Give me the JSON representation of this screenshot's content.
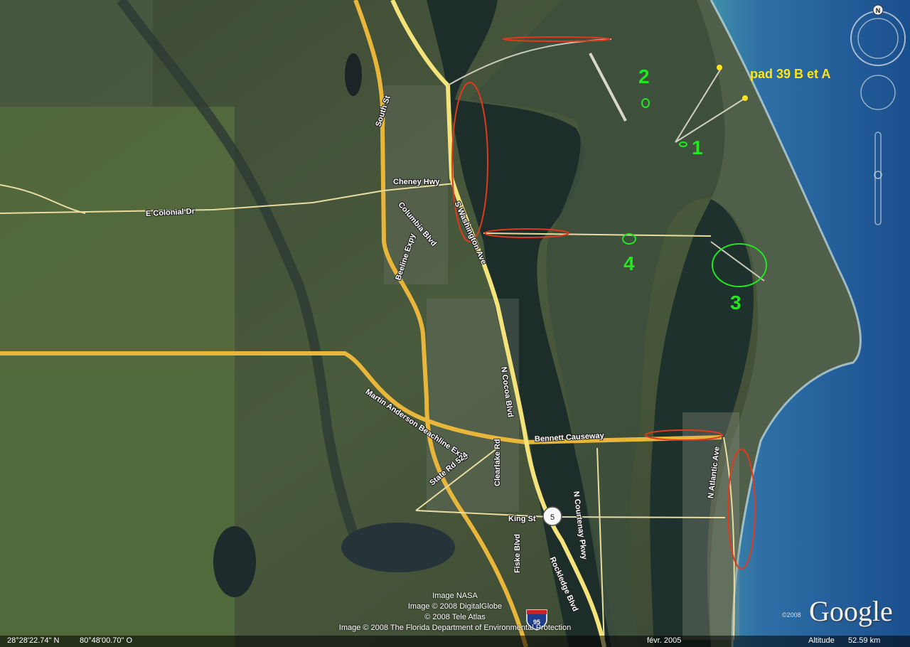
{
  "roads": {
    "south_st": "South St",
    "cheney_hwy": "Cheney Hwy",
    "colonial": "E Colonial Dr",
    "columbia": "Columbia Blvd",
    "beeline": "Beeline Expy",
    "s_washington": "S Washington Ave",
    "n_cocoa": "N Cocoa Blvd",
    "martin_anderson": "Martin Anderson Beachline Expy",
    "bennett": "Bennett Causeway",
    "n_courtenay": "N Courtenay Pkwy",
    "state_rd": "State Rd 524",
    "clearlake": "Clearlake Rd",
    "king_st": "King St",
    "fiske": "Fiske Blvd",
    "rockledge": "Rockledge Blvd",
    "n_atlantic": "N Atlantic Ave",
    "i95_shield": "95",
    "route5": "5"
  },
  "markers": {
    "m1": "1",
    "m2": "2",
    "m3": "3",
    "m4": "4",
    "pad_label": "pad 39 B et A"
  },
  "credits": {
    "line1": "Image NASA",
    "line2": "Image © 2008 DigitalGlobe",
    "line3": "© 2008 Tele Atlas",
    "line4": "Image © 2008 The Florida Department of Environmental Protection"
  },
  "status": {
    "lat": "28°28'22.74\" N",
    "lon": "80°48'00.70\" O",
    "date": "févr. 2005",
    "altitude_label": "Altitude",
    "altitude_value": "52.59 km"
  },
  "branding": {
    "google": "Google",
    "year": "©2008"
  },
  "nav": {
    "north": "N"
  },
  "colors": {
    "highway": "#e8b63a",
    "primary_road": "#f3e37a",
    "annotation_red": "#e03a1e",
    "annotation_green": "#22e622",
    "pad_yellow": "#ffe41a",
    "ocean": "#1f5fa0",
    "lagoon": "#1d2e2a"
  }
}
